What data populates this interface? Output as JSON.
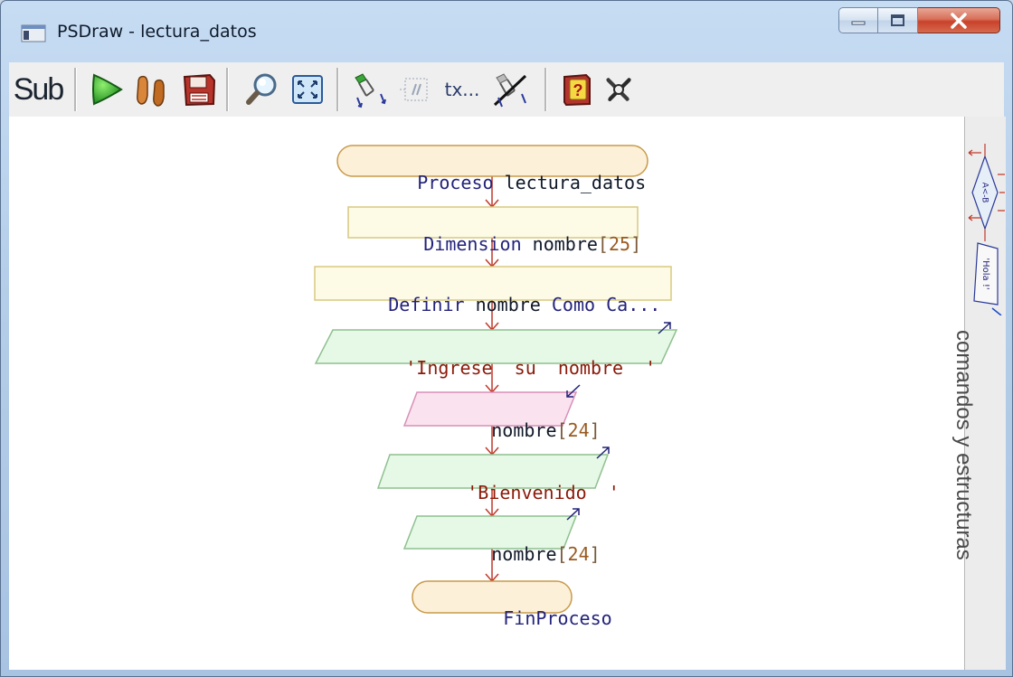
{
  "window": {
    "title": "PSDraw - lectura_datos"
  },
  "toolbar": {
    "sub_label": "Sub",
    "tx_label": "tx...",
    "tools": [
      {
        "name": "sub",
        "icon": "sub-text-icon"
      },
      {
        "name": "run",
        "icon": "play-icon"
      },
      {
        "name": "step",
        "icon": "footprints-icon"
      },
      {
        "name": "save",
        "icon": "floppy-disk-icon"
      },
      {
        "name": "zoom",
        "icon": "magnifier-icon"
      },
      {
        "name": "fit",
        "icon": "fit-window-icon"
      },
      {
        "name": "style",
        "icon": "flowchart-style-icon"
      },
      {
        "name": "comments",
        "icon": "comment-icon"
      },
      {
        "name": "text",
        "icon": "text-icon"
      },
      {
        "name": "no-style",
        "icon": "crossed-style-icon"
      },
      {
        "name": "help",
        "icon": "help-book-icon"
      },
      {
        "name": "close",
        "icon": "close-x-icon"
      }
    ]
  },
  "flowchart": {
    "start": {
      "kw": "Proceso",
      "name": "lectura_datos"
    },
    "dim": {
      "kw": "Dimension",
      "var": "nombre",
      "lb": "[",
      "num": "25",
      "rb": "]"
    },
    "def": {
      "kw1": "Definir",
      "var": "nombre",
      "kw2": "Como",
      "rest": "Ca..."
    },
    "out1": {
      "str": "'Ingrese  su  nombre  '"
    },
    "in1": {
      "var": "nombre",
      "lb": "[",
      "num": "24",
      "rb": "]"
    },
    "out2": {
      "str": "'Bienvenido  '"
    },
    "out3": {
      "var": "nombre",
      "lb": "[",
      "num": "24",
      "rb": "]"
    },
    "end": {
      "kw": "FinProceso"
    }
  },
  "panel": {
    "label": "comandos y estructuras",
    "assign_text": "A<-B",
    "write_text": "'Hola !'"
  },
  "colors": {
    "terminator_fill": "#fdf0d8",
    "terminator_stroke": "#c89a4a",
    "process_fill": "#fdfbe6",
    "process_stroke": "#d8c880",
    "output_fill": "#e6f8e6",
    "output_stroke": "#8fc08f",
    "input_fill": "#fbe2ef",
    "input_stroke": "#d890b8",
    "connector": "#c0392b"
  }
}
